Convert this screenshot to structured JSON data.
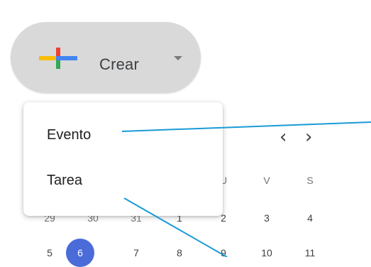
{
  "create_button": {
    "label": "Crear"
  },
  "create_menu": {
    "items": [
      {
        "label": "Evento"
      },
      {
        "label": "Tarea"
      }
    ]
  },
  "mini_calendar": {
    "weekday_headers": [
      "U",
      "V",
      "S"
    ],
    "week_row": [
      "29",
      "30",
      "31",
      "1",
      "2",
      "3",
      "4"
    ],
    "next_row_partial": [
      "5",
      "6",
      "7",
      "8",
      "9",
      "10",
      "11"
    ]
  },
  "colors": {
    "create_bg": "#d9d9d9",
    "plus_red": "#ea4335",
    "plus_blue": "#4285f4",
    "plus_green": "#34a853",
    "plus_yellow": "#fbbc04",
    "today_circle": "#4a6bd8",
    "annotation_line": "#1a9bd7"
  },
  "icons": {
    "create_plus": "multicolor-plus-icon",
    "create_caret": "caret-down-icon",
    "prev": "chevron-left-icon",
    "next": "chevron-right-icon"
  }
}
